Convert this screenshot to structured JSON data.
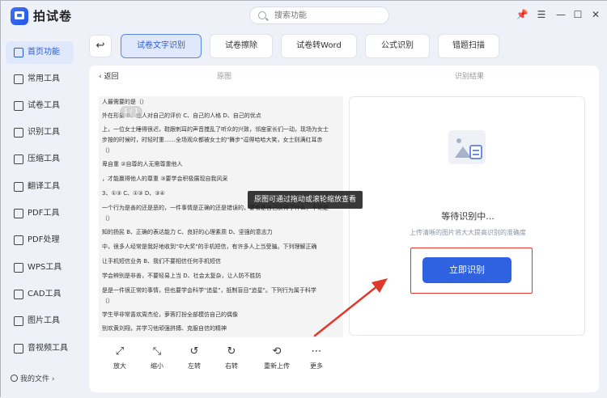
{
  "app": {
    "title": "拍试卷"
  },
  "search": {
    "placeholder": "搜索功能"
  },
  "window": {
    "pin": "📌",
    "menu": "☰",
    "minimize": "—",
    "maximize": "☐",
    "close": "✕"
  },
  "sidebar": {
    "items": [
      {
        "label": "首页功能",
        "icon": "home-icon"
      },
      {
        "label": "常用工具",
        "icon": "layers-icon"
      },
      {
        "label": "试卷工具",
        "icon": "paper-icon"
      },
      {
        "label": "识别工具",
        "icon": "scan-icon"
      },
      {
        "label": "压缩工具",
        "icon": "compress-icon"
      },
      {
        "label": "翻译工具",
        "icon": "translate-icon"
      },
      {
        "label": "PDF工具",
        "icon": "pdf-icon"
      },
      {
        "label": "PDF处理",
        "icon": "pdf-process-icon"
      },
      {
        "label": "WPS工具",
        "icon": "wps-icon"
      },
      {
        "label": "CAD工具",
        "icon": "cad-icon"
      },
      {
        "label": "图片工具",
        "icon": "image-icon"
      },
      {
        "label": "音视频工具",
        "icon": "media-icon"
      }
    ],
    "my_files": "我的文件 ›"
  },
  "tools": {
    "back": "↩",
    "tabs": [
      "试卷文字识别",
      "试卷擦除",
      "试卷转Word",
      "公式识别",
      "错题扫描"
    ]
  },
  "panel": {
    "back_link": "‹ 返回",
    "original_label": "原图",
    "result_label": "识别结果"
  },
  "document": {
    "page_indicator": "1 / 1",
    "lines": [
      "人最需要的是（）",
      "外在形象 B、他人对自己的评价 C、自己的人格 D、自己的优点",
      "上，一位女士睡得很迟，鞋跟刺耳的声音搅乱了听众的兴致，邻座家长们一动，现场为女士",
      "步按的时候时，时轻时重……全场观众都被女士的\"舞步\"逗得哈哈大笑，女士则满红耳赤",
      "（）",
      "卑自重    ②自尊的人无需尊重他人",
      "，才能赢得他人的尊重  ③要学会积极展现自我风采",
      "3、①③ C、①③ D、③④",
      "一个行为是善的还是恶的，一件事情是正确的还是错误的，要看是自己获得了什么，不论是",
      "（）",
      "知的扬民 B、正确的表达能力 C、良好的心理素质 D、坚强的意志力",
      "中，很多人经常是我好地收到\"中大奖\"的手机短信，有许多人上当受骗。下列理解正确",
      "让手机短信业务  B、我们不要相信任何手机短信",
      "学会辨别是非善，不要轻易上当 D、社会太复杂，让人防不胜防",
      "是是一件很正常的事情，但也要学会科学\"追星\"，抵制盲目\"追星\"。下列行为属于科学",
      "（）",
      "学生甲非常喜欢周杰伦，萝蓉打扮全部模仿自己的偶像",
      "别欢黄刘翔，并学习他顽强拼搏、克服自信的精神"
    ],
    "tooltip": "原图可通过拖动或滚轮缩放查看"
  },
  "doc_toolbar": [
    {
      "label": "放大",
      "glyph": "⤢",
      "icon": "zoom-in-icon"
    },
    {
      "label": "缩小",
      "glyph": "⤡",
      "icon": "zoom-out-icon"
    },
    {
      "label": "左转",
      "glyph": "↺",
      "icon": "rotate-left-icon"
    },
    {
      "label": "右转",
      "glyph": "↻",
      "icon": "rotate-right-icon"
    },
    {
      "label": "重新上传",
      "glyph": "⟲",
      "icon": "reupload-icon"
    },
    {
      "label": "更多",
      "glyph": "⋯",
      "icon": "more-icon"
    }
  ],
  "result": {
    "waiting": "等待识别中...",
    "hint": "上传清晰的图片将大大提高识别的准确度",
    "start_button": "立即识别"
  },
  "colors": {
    "accent": "#2f62e0",
    "highlight": "#e0392b",
    "background": "#eef1f8"
  }
}
